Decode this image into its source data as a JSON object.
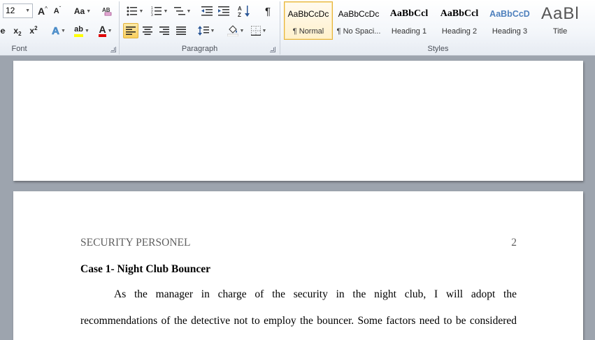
{
  "ribbon": {
    "font": {
      "group_label": "Font",
      "font_size": "12",
      "grow_font_glyph": "A",
      "shrink_font_glyph": "A",
      "change_case_label": "Aa",
      "subscript_label": "x",
      "superscript_label": "x",
      "highlight_label": "ab",
      "font_color_label": "A"
    },
    "paragraph": {
      "group_label": "Paragraph",
      "show_marks_glyph": "¶"
    },
    "styles": {
      "group_label": "Styles",
      "items": [
        {
          "preview": "AaBbCcDc",
          "name": "¶ Normal",
          "selected": true
        },
        {
          "preview": "AaBbCcDc",
          "name": "¶ No Spaci..."
        },
        {
          "preview": "AaBbCcl",
          "name": "Heading 1"
        },
        {
          "preview": "AaBbCcl",
          "name": "Heading 2"
        },
        {
          "preview": "AaBbCcD",
          "name": "Heading 3"
        },
        {
          "preview": "AaBl",
          "name": "Title"
        }
      ]
    },
    "colors": {
      "highlight": "#ffff00",
      "font_color": "#e00000",
      "heading_blue": "#4f81bd",
      "selected_border": "#e6b43c"
    }
  },
  "document": {
    "header_text": "SECURITY PERSONEL",
    "page_number": "2",
    "case_heading": "Case 1- Night Club Bouncer",
    "paragraph_line_1": "As the manager in charge of the security in the night club, I will adopt the",
    "paragraph_line_2": "recommendations of the detective not to employ the bouncer. Some factors need to be considered"
  }
}
